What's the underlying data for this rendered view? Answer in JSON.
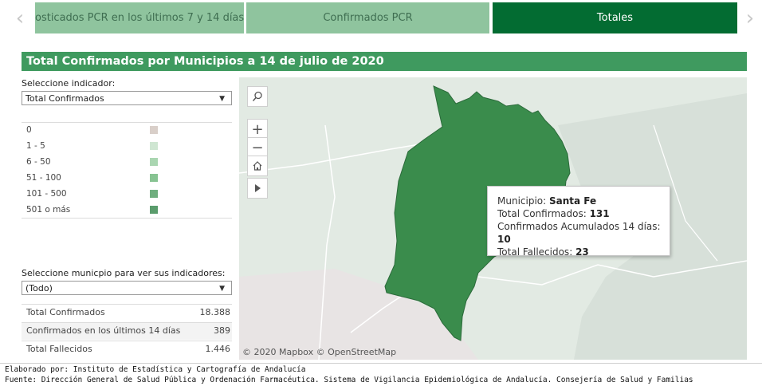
{
  "tabs": [
    {
      "label": "osticados PCR en los últimos 7 y 14 días",
      "active": false
    },
    {
      "label": "Confirmados PCR",
      "active": false
    },
    {
      "label": "Totales",
      "active": true
    }
  ],
  "nav": {
    "prev": "‹",
    "next": "›"
  },
  "title": "Total Confirmados por Municipios a 14 de julio de 2020",
  "indicator": {
    "label": "Seleccione indicador:",
    "selected": "Total Confirmados"
  },
  "legend": [
    {
      "range": "0",
      "color": "#d9cfc9"
    },
    {
      "range": "1 - 5",
      "color": "#cfe6d2"
    },
    {
      "range": "6 - 50",
      "color": "#aad6b1"
    },
    {
      "range": "51 - 100",
      "color": "#87c392"
    },
    {
      "range": "101 - 500",
      "color": "#6fae7e"
    },
    {
      "range": "501 o más",
      "color": "#5a9c6c"
    }
  ],
  "municipio": {
    "label": "Seleccione municpio para ver sus indicadores:",
    "selected": "(Todo)"
  },
  "indicators": [
    {
      "name": "Total Confirmados",
      "value": "18.388"
    },
    {
      "name": "Confirmados en los últimos 14 días",
      "value": "389"
    },
    {
      "name": "Total Fallecidos",
      "value": "1.446"
    }
  ],
  "map_controls": {
    "search": "search-icon",
    "zoom_in": "+",
    "zoom_out": "−",
    "home": "home-icon",
    "play": "play-icon"
  },
  "tooltip": {
    "municipio_label": "Municipio:",
    "municipio_value": "Santa Fe",
    "total_label": "Total Confirmados:",
    "total_value": "131",
    "acum_label": "Confirmados Acumulados 14 días:",
    "acum_value": "10",
    "fall_label": "Total Fallecidos:",
    "fall_value": "23"
  },
  "attribution": "© 2020 Mapbox  © OpenStreetMap",
  "footer": {
    "line1": "Elaborado por: Instituto de Estadística y Cartografía de Andalucía",
    "line2": "Fuente: Dirección General de Salud Pública y Ordenación Farmacéutica. Sistema de Vigilancia Epidemiológica de Andalucía. Consejería de Salud y Familias"
  },
  "colors": {
    "region": "#3a8c4c",
    "accent": "#036c32",
    "tab": "#8fc49e",
    "title_bg": "#3f9a5f"
  }
}
